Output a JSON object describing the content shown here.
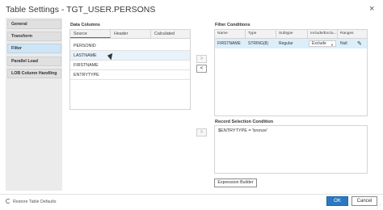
{
  "dialog": {
    "title": "Table Settings - TGT_USER.PERSONS",
    "close_glyph": "×"
  },
  "nav": {
    "items": [
      {
        "label": "General"
      },
      {
        "label": "Transform"
      },
      {
        "label": "Filter",
        "active": true
      },
      {
        "label": "Parallel Load"
      },
      {
        "label": "LOB Column Handling"
      }
    ]
  },
  "data_columns": {
    "label": "Data Columns",
    "tabs": [
      "Source",
      "Header",
      "Calculated"
    ],
    "active_tab": "Source",
    "rows": [
      "PERSONID",
      "LASTNAME",
      "FIRSTNAME",
      "ENTRYTYPE"
    ],
    "hovered_row": "LASTNAME"
  },
  "mid_buttons": {
    "add": ">",
    "remove": "<",
    "add_condition": ">"
  },
  "filter_conditions": {
    "label": "Filter Conditions",
    "columns": [
      "Name",
      "Type",
      "Subtype",
      "Include/Exclu...",
      "Ranges"
    ],
    "rows": [
      {
        "name": "FIRSTNAME",
        "type": "STRING(8)",
        "subtype": "Regular",
        "include": "Exclude",
        "ranges": "Null"
      }
    ],
    "edit_icon": "pencil-icon"
  },
  "record_selection": {
    "label": "Record Selection Condition",
    "value": "$ENTRYTYPE = 'bronze'"
  },
  "expression_builder_label": "Expression Builder",
  "footer": {
    "restore_label": "Restore Table Defaults",
    "ok_label": "OK",
    "cancel_label": "Cancel"
  },
  "colors": {
    "accent": "#2979c2",
    "selected_nav": "#cfe4f4",
    "selected_row": "#dceefa"
  }
}
